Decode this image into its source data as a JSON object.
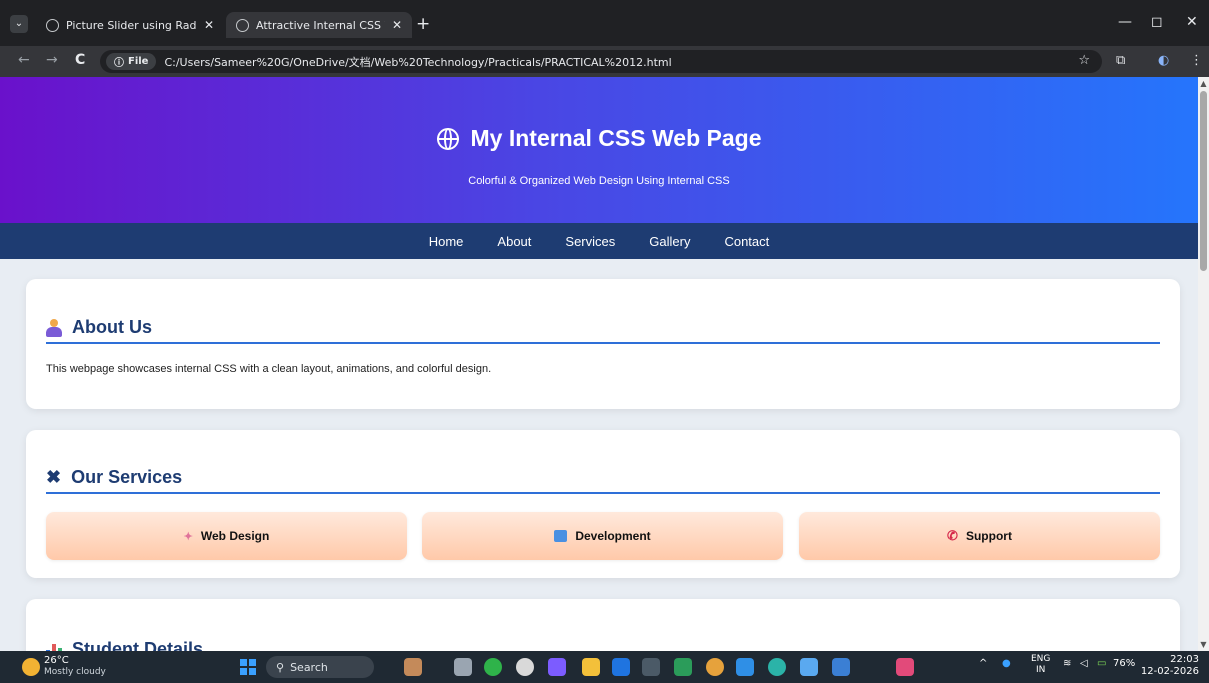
{
  "browser": {
    "tabs": [
      {
        "title": "Picture Slider using Radio Butt",
        "active": false
      },
      {
        "title": "Attractive Internal CSS Web Pag",
        "active": true
      }
    ],
    "new_tab_label": "+",
    "close_glyph": "✕",
    "back_glyph": "←",
    "forward_glyph": "→",
    "reload_glyph": "C",
    "info_chip_label": "File",
    "url": "C:/Users/Sameer%20G/OneDrive/文档/Web%20Technology/Practicals/PRACTICAL%2012.html",
    "bookmark_glyph": "☆",
    "minimize_glyph": "—",
    "restore_glyph": "◻",
    "window_close_glyph": "✕",
    "menu_glyph": "⋮"
  },
  "page": {
    "hero": {
      "title": "My Internal CSS Web Page",
      "subtitle": "Colorful & Organized Web Design Using Internal CSS"
    },
    "nav": [
      "Home",
      "About",
      "Services",
      "Gallery",
      "Contact"
    ],
    "about": {
      "heading": "About Us",
      "text": "This webpage showcases internal CSS with a clean layout, animations, and colorful design."
    },
    "services": {
      "heading": "Our Services",
      "items": [
        "Web Design",
        "Development",
        "Support"
      ]
    },
    "students": {
      "heading": "Student Details"
    },
    "colors": {
      "hero_gradient_start": "#6a11cb",
      "hero_gradient_end": "#2575fc",
      "nav_background": "#1e3c72",
      "heading_color": "#1e3c72",
      "service_button_start": "#ffe9dc",
      "service_button_end": "#ffc9a9"
    }
  },
  "taskbar": {
    "temperature": "26°C",
    "weather": "Mostly cloudy",
    "search_label": "Search",
    "language_top": "ENG",
    "language_bottom": "IN",
    "battery": "76%",
    "time": "22:03",
    "date": "12-02-2026"
  }
}
